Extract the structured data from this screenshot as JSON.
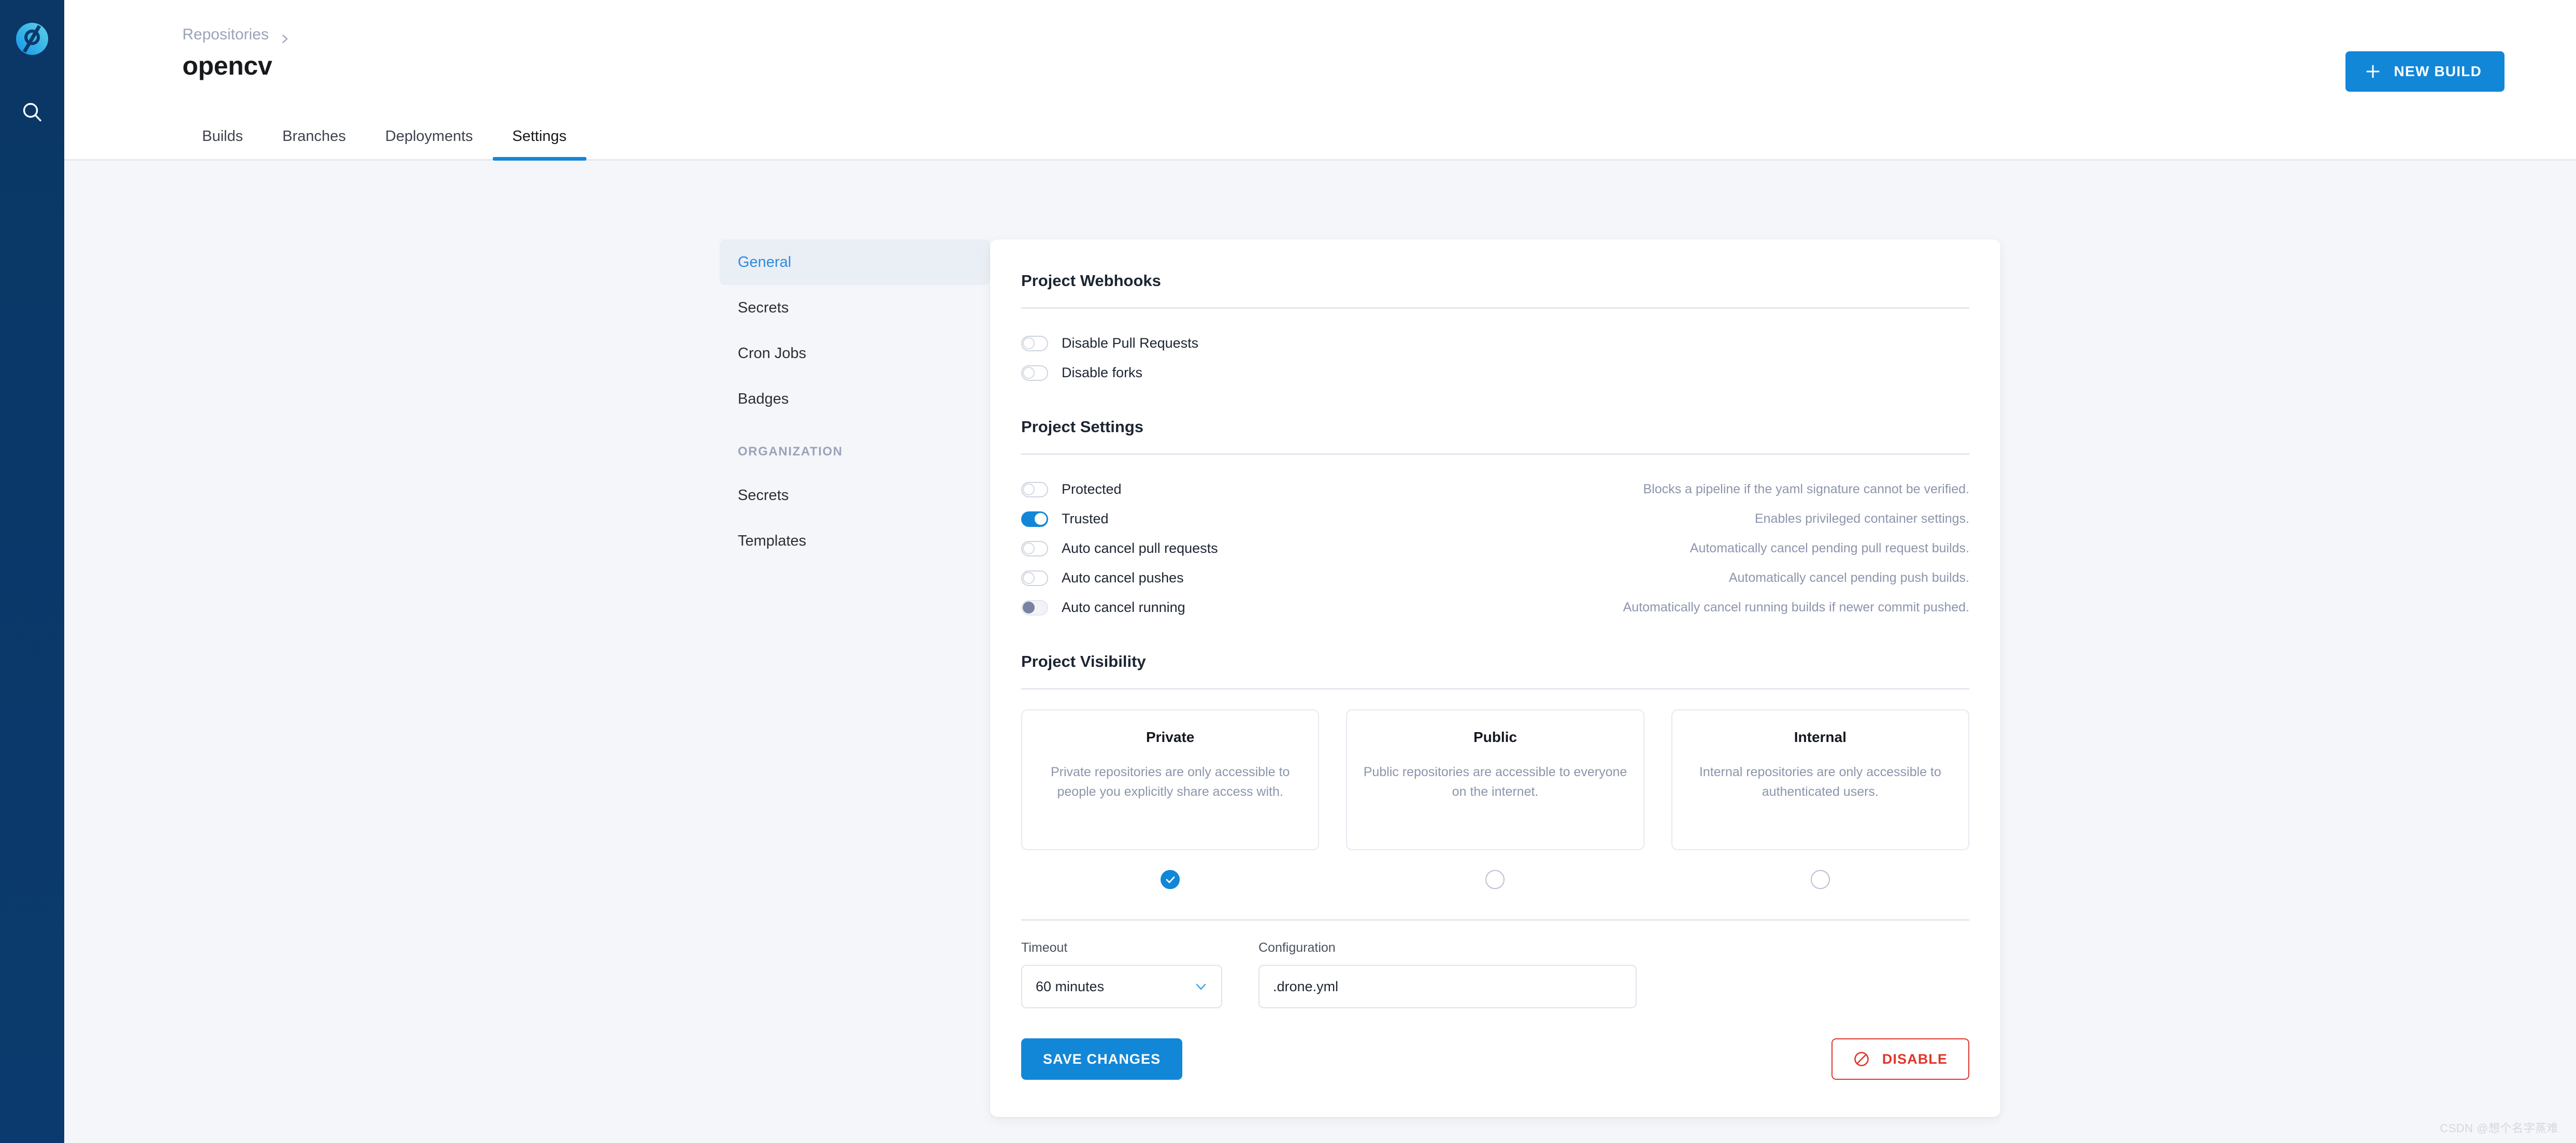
{
  "rail": {
    "logo_icon": "drone-logo-icon",
    "search_icon": "search-icon"
  },
  "header": {
    "breadcrumb_root": "Repositories",
    "breadcrumb_separator_icon": "chevron-right-icon",
    "title": "opencv",
    "new_build_label": "NEW BUILD",
    "new_build_icon": "plus-icon"
  },
  "tabs": [
    {
      "label": "Builds",
      "active": false
    },
    {
      "label": "Branches",
      "active": false
    },
    {
      "label": "Deployments",
      "active": false
    },
    {
      "label": "Settings",
      "active": true
    }
  ],
  "settings_nav": {
    "items": [
      {
        "label": "General",
        "active": true
      },
      {
        "label": "Secrets",
        "active": false
      },
      {
        "label": "Cron Jobs",
        "active": false
      },
      {
        "label": "Badges",
        "active": false
      }
    ],
    "section_label": "ORGANIZATION",
    "org_items": [
      {
        "label": "Secrets",
        "active": false
      },
      {
        "label": "Templates",
        "active": false
      }
    ]
  },
  "webhooks": {
    "title": "Project Webhooks",
    "rows": [
      {
        "label": "Disable Pull Requests",
        "state": "off",
        "desc": ""
      },
      {
        "label": "Disable forks",
        "state": "off",
        "desc": ""
      }
    ]
  },
  "project_settings": {
    "title": "Project Settings",
    "rows": [
      {
        "label": "Protected",
        "state": "off",
        "desc": "Blocks a pipeline if the yaml signature cannot be verified."
      },
      {
        "label": "Trusted",
        "state": "on",
        "desc": "Enables privileged container settings."
      },
      {
        "label": "Auto cancel pull requests",
        "state": "off",
        "desc": "Automatically cancel pending pull request builds."
      },
      {
        "label": "Auto cancel pushes",
        "state": "off",
        "desc": "Automatically cancel pending push builds."
      },
      {
        "label": "Auto cancel running",
        "state": "muted",
        "desc": "Automatically cancel running builds if newer commit pushed."
      }
    ]
  },
  "visibility": {
    "title": "Project Visibility",
    "options": [
      {
        "name": "Private",
        "desc": "Private repositories are only accessible to people you explicitly share access with.",
        "selected": true
      },
      {
        "name": "Public",
        "desc": "Public repositories are accessible to everyone on the internet.",
        "selected": false
      },
      {
        "name": "Internal",
        "desc": "Internal repositories are only accessible to authenticated users.",
        "selected": false
      }
    ]
  },
  "form": {
    "timeout_label": "Timeout",
    "timeout_value": "60 minutes",
    "timeout_chevron_icon": "chevron-down-icon",
    "configuration_label": "Configuration",
    "configuration_value": ".drone.yml"
  },
  "footer": {
    "save_label": "SAVE CHANGES",
    "disable_label": "DISABLE",
    "disable_icon": "ban-icon"
  },
  "watermark": "CSDN @想个名字蒸难",
  "colors": {
    "accent": "#1287d8",
    "rail": "#0b3a6b",
    "danger": "#e0352b",
    "page_bg": "#f4f6f9",
    "muted_text": "#8d95ab"
  }
}
